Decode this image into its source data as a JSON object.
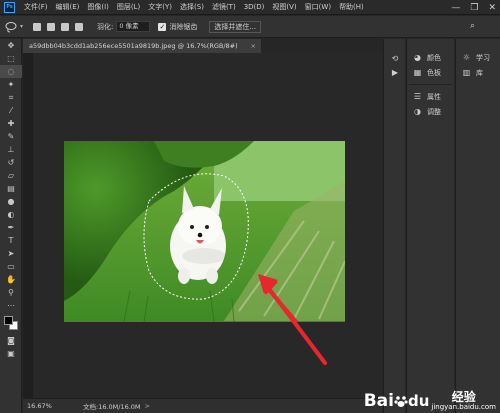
{
  "app": {
    "logo": "Ps"
  },
  "menu": [
    "文件(F)",
    "编辑(E)",
    "图像(I)",
    "图层(L)",
    "文字(Y)",
    "选择(S)",
    "滤镜(T)",
    "3D(D)",
    "视图(V)",
    "窗口(W)",
    "帮助(H)"
  ],
  "window_controls": {
    "minimize": "—",
    "restore": "❐",
    "close": "✕"
  },
  "options": {
    "feather_label": "羽化:",
    "feather_value": "0 像素",
    "antialias_checked": true,
    "antialias_label": "消除锯齿",
    "select_mask_button": "选择并遮住..."
  },
  "document": {
    "tab_title": "a59dbb04b3cdd1ab256ece5501a9819b.jpeg @ 16.7%(RGB/8#)",
    "close": "×"
  },
  "status": {
    "zoom": "16.67%",
    "doc_size": "文档:16.0M/16.0M",
    "arrow": ">"
  },
  "panels": {
    "group1": [
      {
        "icon": "palette-icon",
        "label": "颜色"
      },
      {
        "icon": "swatches-icon",
        "label": "色板"
      }
    ],
    "group2": [
      {
        "icon": "properties-icon",
        "label": "属性"
      },
      {
        "icon": "adjustments-icon",
        "label": "调整"
      }
    ],
    "group3": [
      {
        "icon": "learn-icon",
        "label": "学习"
      },
      {
        "icon": "library-icon",
        "label": "库"
      }
    ]
  },
  "watermark": {
    "brand": "Bai",
    "brand_tail": "du",
    "jy_top": "经验",
    "jy_bottom": "jingyan.baidu.com"
  },
  "colors": {
    "accent": "#31a8ff",
    "arrow": "#e8262e"
  }
}
